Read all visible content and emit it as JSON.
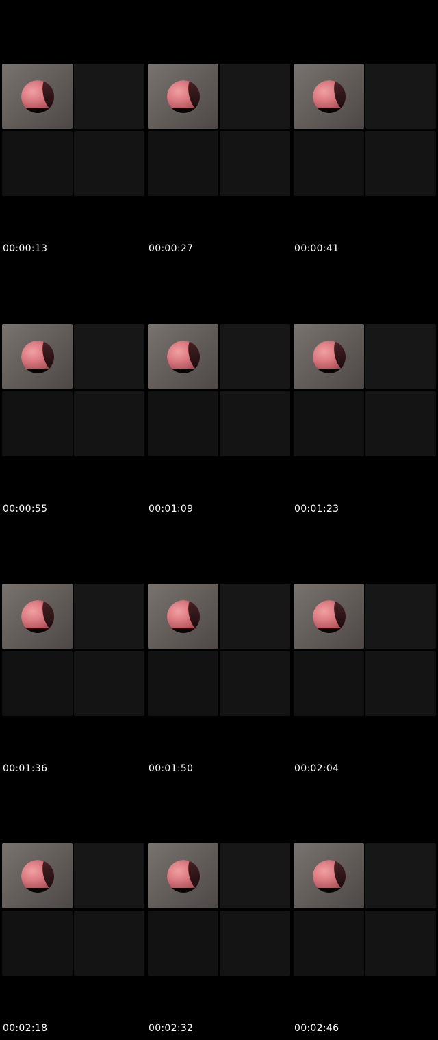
{
  "timestamps": [
    "00:00:13",
    "00:00:27",
    "00:00:41",
    "00:00:55",
    "00:01:09",
    "00:01:23",
    "00:01:36",
    "00:01:50",
    "00:02:04",
    "00:02:18",
    "00:02:32",
    "00:02:46"
  ],
  "colors": {
    "background": "#000000",
    "timestamp_text": "#ffffff",
    "tissue": "#dc7c83"
  },
  "icons": {
    "frame_content": "endoscope-lens-thumbnail"
  }
}
